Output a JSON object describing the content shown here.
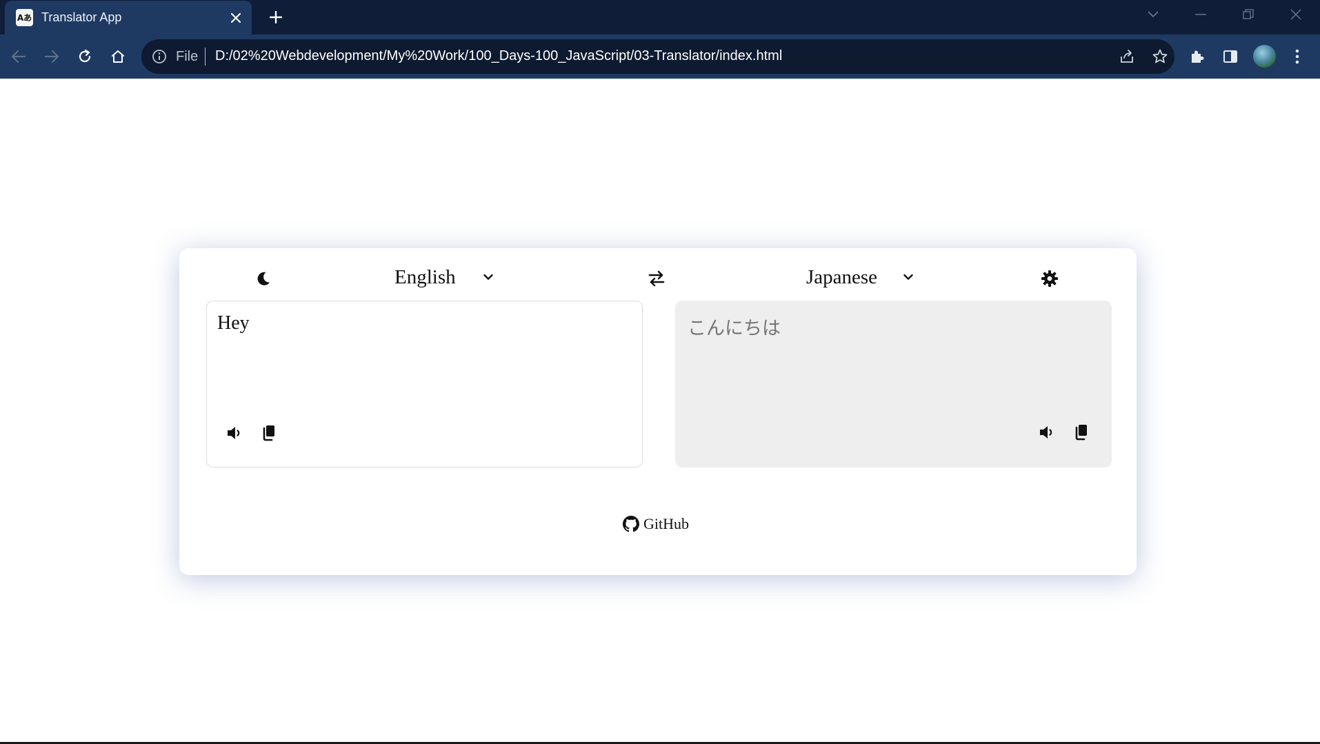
{
  "browser": {
    "tab_title": "Translator App",
    "favicon_text": "Aあ",
    "address": {
      "scheme_label": "File",
      "url": "D:/02%20Webdevelopment/My%20Work/100_Days-100_JavaScript/03-Translator/index.html"
    }
  },
  "app": {
    "theme_toggle_icon": "moon-icon",
    "settings_icon": "gear-icon",
    "swap_icon": "swap-arrows-icon",
    "source_language": "English",
    "target_language": "Japanese",
    "source_text": "Hey",
    "translated_text": "こんにちは",
    "footer_link": "GitHub"
  },
  "colors": {
    "tabbar_bg": "#0f1d39",
    "toolbar_bg": "#1e3a63",
    "omnibox_bg": "#0e1a30",
    "card_bg": "#ffffff",
    "output_panel_bg": "#eeeeee",
    "output_text": "#757575"
  }
}
